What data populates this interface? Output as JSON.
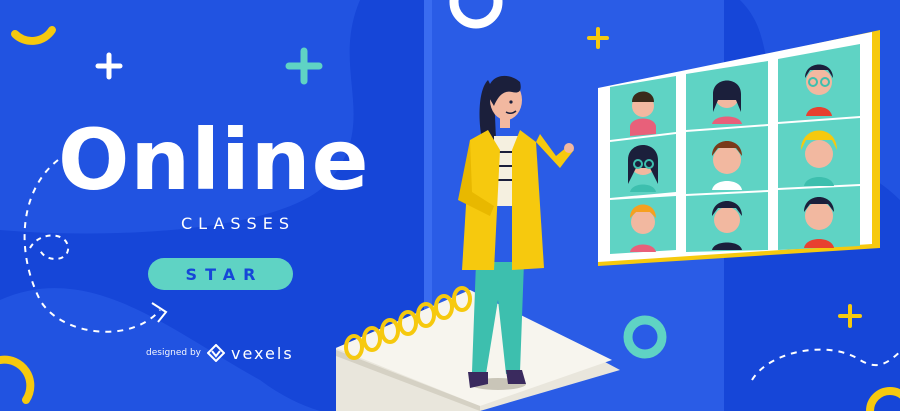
{
  "banner": {
    "title": "Online",
    "subtitle": "CLASSES",
    "button_label": "STAR",
    "credit": {
      "prefix": "designed by",
      "brand": "vexels"
    }
  },
  "colors": {
    "background": "#1646d8",
    "panel": "#2a5ce6",
    "accent_teal": "#5fd3c4",
    "accent_yellow": "#f6c90e",
    "white": "#ffffff"
  },
  "icons": [
    "plus-icon",
    "ring-icon",
    "dashed-path",
    "vexels-logo-icon"
  ]
}
